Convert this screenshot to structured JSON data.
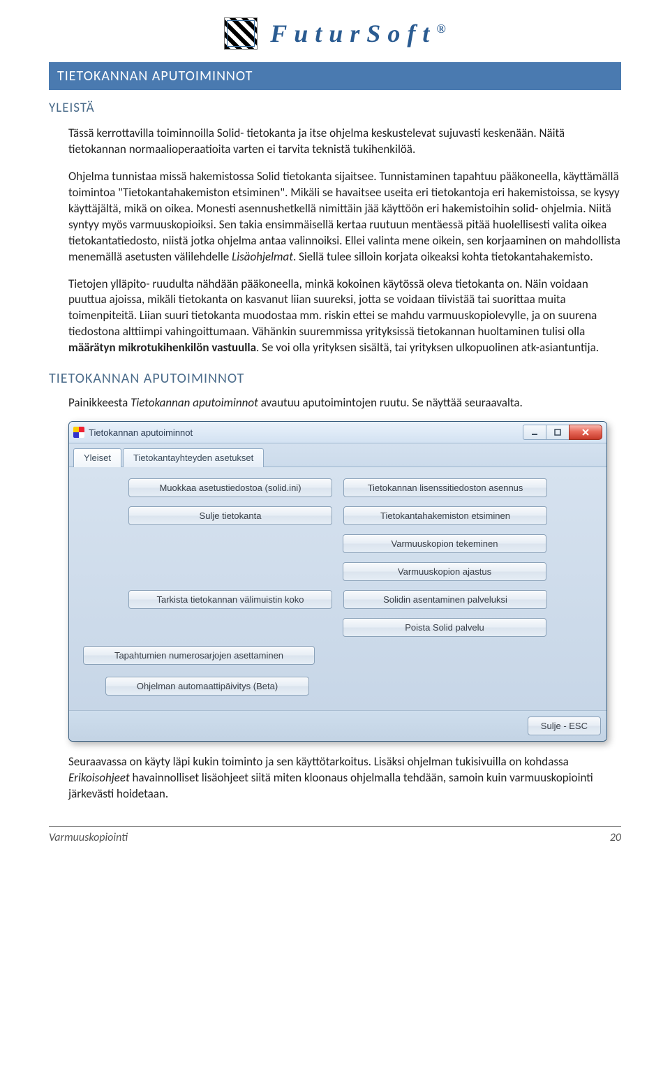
{
  "logo": {
    "brand": "FuturSoft",
    "registered": "®"
  },
  "banner": "TIETOKANNAN APUTOIMINNOT",
  "heading_yleista": "YLEISTÄ",
  "para1_html": "Tässä kerrottavilla toiminnoilla Solid- tietokanta ja itse ohjelma keskustelevat sujuvasti keskenään. Näitä tietokannan normaalioperaatioita varten ei tarvita teknistä tukihenkilöä.",
  "para2_html": "Ohjelma tunnistaa missä hakemistossa Solid tietokanta sijaitsee. Tunnistaminen tapahtuu pääkoneella, käyttämällä toimintoa \"Tietokantahakemiston etsiminen\". Mikäli se havaitsee useita eri tietokantoja eri hakemistoissa, se kysyy käyttäjältä, mikä on oikea. Monesti asennushetkellä nimittäin jää käyttöön eri hakemistoihin solid- ohjelmia. Niitä syntyy myös varmuuskopioiksi. Sen takia ensimmäisellä kertaa ruutuun mentäessä pitää huolellisesti valita oikea tietokantatiedosto, niistä jotka ohjelma antaa valinnoiksi. Ellei valinta mene oikein, sen korjaaminen on mahdollista menemällä asetusten välilehdelle <em>Lisäohjelmat</em>. Siellä tulee silloin korjata oikeaksi kohta tietokantahakemisto.",
  "para3_html": "Tietojen ylläpito- ruudulta nähdään pääkoneella, minkä kokoinen käytössä oleva tietokanta on. Näin voidaan puuttua ajoissa, mikäli tietokanta on kasvanut liian suureksi, jotta se voidaan tiivistää tai suorittaa muita toimenpiteitä. Liian suuri tietokanta muodostaa mm. riskin ettei se mahdu varmuuskopiolevylle, ja on suurena tiedostona alttiimpi vahingoittumaan. Vähänkin suuremmissa yrityksissä tietokannan huoltaminen tulisi olla <strong>määrätyn mikrotukihenkilön vastuulla</strong>. Se voi olla yrityksen sisältä, tai yrityksen ulkopuolinen atk-asiantuntija.",
  "heading2": "TIETOKANNAN APUTOIMINNOT",
  "caption_html": "Painikkeesta <em>Tietokannan aputoiminnot</em> avautuu aputoimintojen ruutu. Se näyttää seuraavalta.",
  "window": {
    "title": "Tietokannan aputoiminnot",
    "tabs": {
      "active": "Yleiset",
      "other": "Tietokantayhteyden asetukset"
    },
    "buttons": {
      "edit_settings": "Muokkaa asetustiedostoa (solid.ini)",
      "license_install": "Tietokannan lisenssitiedoston asennus",
      "close_db": "Sulje tietokanta",
      "find_dir": "Tietokantahakemiston etsiminen",
      "backup_make": "Varmuuskopion tekeminen",
      "backup_sched": "Varmuuskopion ajastus",
      "cache_size": "Tarkista tietokannan välimuistin koko",
      "install_service": "Solidin asentaminen palveluksi",
      "remove_service": "Poista Solid palvelu",
      "set_series": "Tapahtumien numerosarjojen asettaminen",
      "auto_update": "Ohjelman automaattipäivitys (Beta)",
      "close_esc": "Sulje - ESC"
    }
  },
  "para4_html": "Seuraavassa on käyty läpi kukin toiminto ja sen käyttötarkoitus. Lisäksi ohjelman tukisivuilla on kohdassa <em>Erikoisohjeet</em> havainnolliset lisäohjeet siitä miten kloonaus ohjelmalla tehdään, samoin kuin varmuuskopiointi järkevästi hoidetaan.",
  "footer": {
    "left": "Varmuuskopiointi",
    "right": "20"
  }
}
